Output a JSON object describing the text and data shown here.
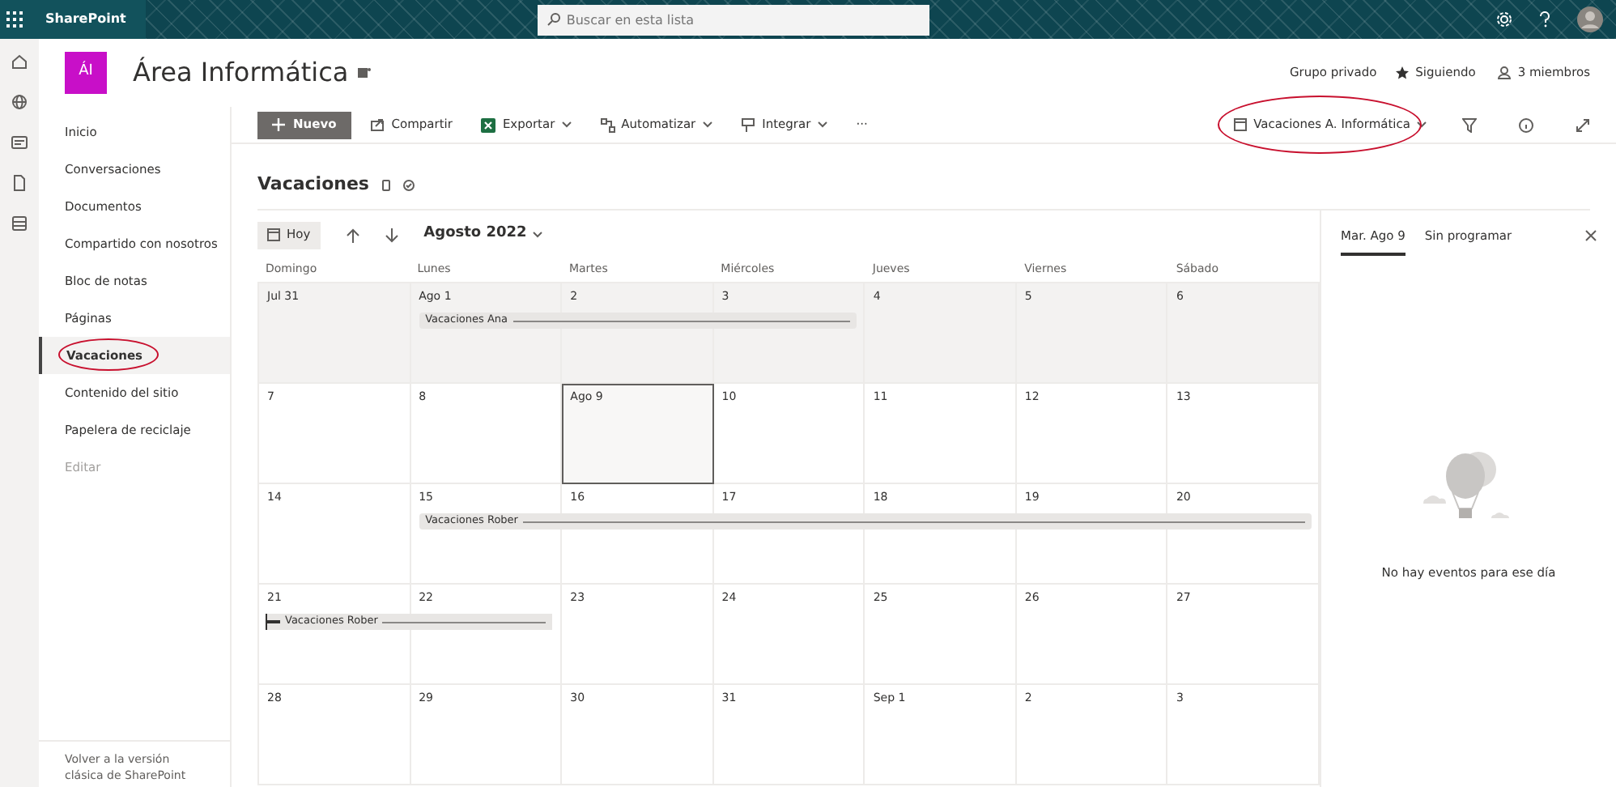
{
  "top_bar": {
    "app_name": "SharePoint",
    "search": {
      "placeholder": "Buscar en esta lista"
    }
  },
  "site": {
    "logo": "ÁI",
    "title": "Área Informática",
    "group": "Grupo privado",
    "follow": "Siguiendo",
    "members": "3 miembros"
  },
  "nav": [
    {
      "label": "Inicio",
      "selected": false
    },
    {
      "label": "Conversaciones",
      "selected": false
    },
    {
      "label": "Documentos",
      "selected": false
    },
    {
      "label": "Compartido con nosotros",
      "selected": false
    },
    {
      "label": "Bloc de notas",
      "selected": false
    },
    {
      "label": "Páginas",
      "selected": false
    },
    {
      "label": "Vacaciones",
      "selected": true
    },
    {
      "label": "Contenido del sitio",
      "selected": false
    },
    {
      "label": "Papelera de reciclaje",
      "selected": false
    },
    {
      "label": "Editar",
      "selected": false,
      "kind": "muted"
    }
  ],
  "nav_footer": "Volver a la versión clásica de SharePoint",
  "commands": [
    {
      "label": "Nuevo",
      "kind": "primary",
      "dropdown": false
    },
    {
      "label": "Compartir",
      "kind": "share",
      "dropdown": false
    },
    {
      "label": "Exportar",
      "kind": "excel",
      "dropdown": true
    },
    {
      "label": "Automatizar",
      "kind": "flow",
      "dropdown": true
    },
    {
      "label": "Integrar",
      "kind": "integrate",
      "dropdown": true
    },
    {
      "label": "···",
      "kind": "more",
      "dropdown": false
    }
  ],
  "view_selector": "Vacaciones A. Informática",
  "list_title": "Vacaciones",
  "calendar": {
    "today_button": "Hoy",
    "month": "Agosto 2022",
    "weekdays": [
      "Domingo",
      "Lunes",
      "Martes",
      "Miércoles",
      "Jueves",
      "Viernes",
      "Sábado"
    ],
    "weeks": [
      {
        "highlighted": true,
        "days": [
          {
            "date": "Jul 31",
            "selected": false
          },
          {
            "date": "Ago 1",
            "selected": false,
            "event": {
              "title": "Vacaciones Ana",
              "continued": false
            }
          },
          {
            "date": "2",
            "selected": false,
            "in_event": true
          },
          {
            "date": "3",
            "selected": false,
            "in_event": true
          },
          {
            "date": "4",
            "selected": false
          },
          {
            "date": "5",
            "selected": false
          },
          {
            "date": "6",
            "selected": false
          }
        ]
      },
      {
        "highlighted": false,
        "days": [
          {
            "date": "7",
            "selected": false
          },
          {
            "date": "8",
            "selected": false
          },
          {
            "date": "Ago 9",
            "selected": true
          },
          {
            "date": "10",
            "selected": false
          },
          {
            "date": "11",
            "selected": false
          },
          {
            "date": "12",
            "selected": false
          },
          {
            "date": "13",
            "selected": false
          }
        ]
      },
      {
        "highlighted": false,
        "days": [
          {
            "date": "14",
            "selected": false
          },
          {
            "date": "15",
            "selected": false,
            "event": {
              "title": "Vacaciones Rober"
            }
          },
          {
            "date": "16",
            "selected": false,
            "in_event": true
          },
          {
            "date": "17",
            "selected": false,
            "in_event": true
          },
          {
            "date": "18",
            "selected": false,
            "in_event": true
          },
          {
            "date": "19",
            "selected": false,
            "in_event": true
          },
          {
            "date": "20",
            "selected": false,
            "in_event": true
          }
        ]
      },
      {
        "highlighted": false,
        "days": [
          {
            "date": "21",
            "selected": false,
            "event": {
              "title": "Vacaciones Rober",
              "continued": true
            }
          },
          {
            "date": "22",
            "selected": false,
            "in_event": true
          },
          {
            "date": "23",
            "selected": false
          },
          {
            "date": "24",
            "selected": false
          },
          {
            "date": "25",
            "selected": false
          },
          {
            "date": "26",
            "selected": false
          },
          {
            "date": "27",
            "selected": false
          }
        ]
      },
      {
        "highlighted": false,
        "days": [
          {
            "date": "28",
            "selected": false
          },
          {
            "date": "29",
            "selected": false
          },
          {
            "date": "30",
            "selected": false
          },
          {
            "date": "31",
            "selected": false
          },
          {
            "date": "Sep 1",
            "selected": false
          },
          {
            "date": "2",
            "selected": false
          },
          {
            "date": "3",
            "selected": false
          }
        ]
      }
    ]
  },
  "panel": {
    "tabs": [
      {
        "label": "Mar. Ago 9",
        "selected": true
      },
      {
        "label": "Sin programar",
        "selected": false
      }
    ],
    "empty_message": "No hay eventos para ese día"
  }
}
